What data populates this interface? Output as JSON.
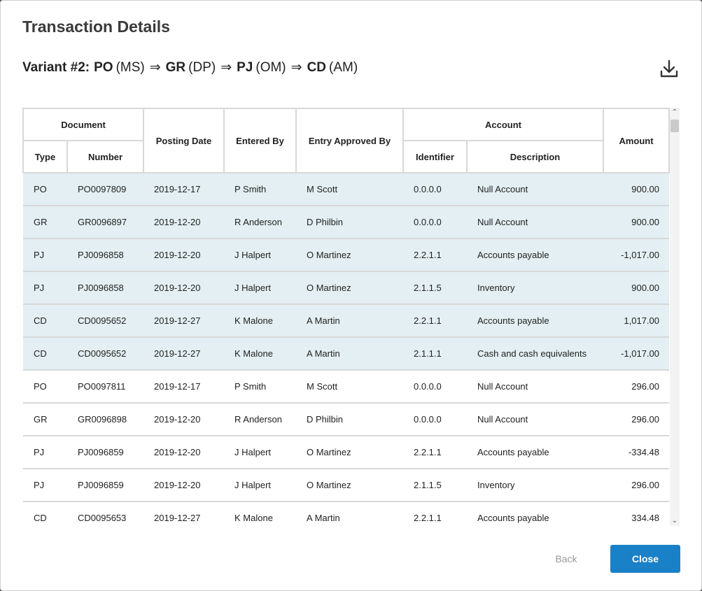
{
  "dialog": {
    "title": "Transaction Details",
    "variant": {
      "label": "Variant #2:",
      "steps": [
        {
          "code": "PO",
          "role": "(MS)"
        },
        {
          "code": "GR",
          "role": "(DP)"
        },
        {
          "code": "PJ",
          "role": "(OM)"
        },
        {
          "code": "CD",
          "role": "(AM)"
        }
      ],
      "arrow": "⇒"
    },
    "download_icon": "download-icon"
  },
  "table": {
    "group_headers": {
      "document": "Document",
      "account": "Account"
    },
    "headers": {
      "type": "Type",
      "number": "Number",
      "posting_date": "Posting Date",
      "entered_by": "Entered By",
      "entry_approved_by": "Entry Approved By",
      "identifier": "Identifier",
      "description": "Description",
      "amount": "Amount"
    },
    "rows": [
      {
        "type": "PO",
        "number": "PO0097809",
        "posting_date": "2019-12-17",
        "entered_by": "P Smith",
        "approved_by": "M Scott",
        "identifier": "0.0.0.0",
        "description": "Null Account",
        "amount": "900.00",
        "highlighted": true
      },
      {
        "type": "GR",
        "number": "GR0096897",
        "posting_date": "2019-12-20",
        "entered_by": "R Anderson",
        "approved_by": "D Philbin",
        "identifier": "0.0.0.0",
        "description": "Null Account",
        "amount": "900.00",
        "highlighted": true
      },
      {
        "type": "PJ",
        "number": "PJ0096858",
        "posting_date": "2019-12-20",
        "entered_by": "J Halpert",
        "approved_by": "O Martinez",
        "identifier": "2.2.1.1",
        "description": "Accounts payable",
        "amount": "-1,017.00",
        "highlighted": true
      },
      {
        "type": "PJ",
        "number": "PJ0096858",
        "posting_date": "2019-12-20",
        "entered_by": "J Halpert",
        "approved_by": "O Martinez",
        "identifier": "2.1.1.5",
        "description": "Inventory",
        "amount": "900.00",
        "highlighted": true
      },
      {
        "type": "CD",
        "number": "CD0095652",
        "posting_date": "2019-12-27",
        "entered_by": "K Malone",
        "approved_by": "A Martin",
        "identifier": "2.2.1.1",
        "description": "Accounts payable",
        "amount": "1,017.00",
        "highlighted": true
      },
      {
        "type": "CD",
        "number": "CD0095652",
        "posting_date": "2019-12-27",
        "entered_by": "K Malone",
        "approved_by": "A Martin",
        "identifier": "2.1.1.1",
        "description": "Cash and cash equivalents",
        "amount": "-1,017.00",
        "highlighted": true
      },
      {
        "type": "PO",
        "number": "PO0097811",
        "posting_date": "2019-12-17",
        "entered_by": "P Smith",
        "approved_by": "M Scott",
        "identifier": "0.0.0.0",
        "description": "Null Account",
        "amount": "296.00",
        "highlighted": false
      },
      {
        "type": "GR",
        "number": "GR0096898",
        "posting_date": "2019-12-20",
        "entered_by": "R Anderson",
        "approved_by": "D Philbin",
        "identifier": "0.0.0.0",
        "description": "Null Account",
        "amount": "296.00",
        "highlighted": false
      },
      {
        "type": "PJ",
        "number": "PJ0096859",
        "posting_date": "2019-12-20",
        "entered_by": "J Halpert",
        "approved_by": "O Martinez",
        "identifier": "2.2.1.1",
        "description": "Accounts payable",
        "amount": "-334.48",
        "highlighted": false
      },
      {
        "type": "PJ",
        "number": "PJ0096859",
        "posting_date": "2019-12-20",
        "entered_by": "J Halpert",
        "approved_by": "O Martinez",
        "identifier": "2.1.1.5",
        "description": "Inventory",
        "amount": "296.00",
        "highlighted": false
      },
      {
        "type": "CD",
        "number": "CD0095653",
        "posting_date": "2019-12-27",
        "entered_by": "K Malone",
        "approved_by": "A Martin",
        "identifier": "2.2.1.1",
        "description": "Accounts payable",
        "amount": "334.48",
        "highlighted": false
      }
    ]
  },
  "scrollbar": {
    "up_glyph": "⌃",
    "down_glyph": "⌄"
  },
  "buttons": {
    "back": "Back",
    "close": "Close"
  },
  "colors": {
    "highlight_row": "#e3eff2",
    "primary": "#1a80c8",
    "border": "#d8d8d8"
  }
}
